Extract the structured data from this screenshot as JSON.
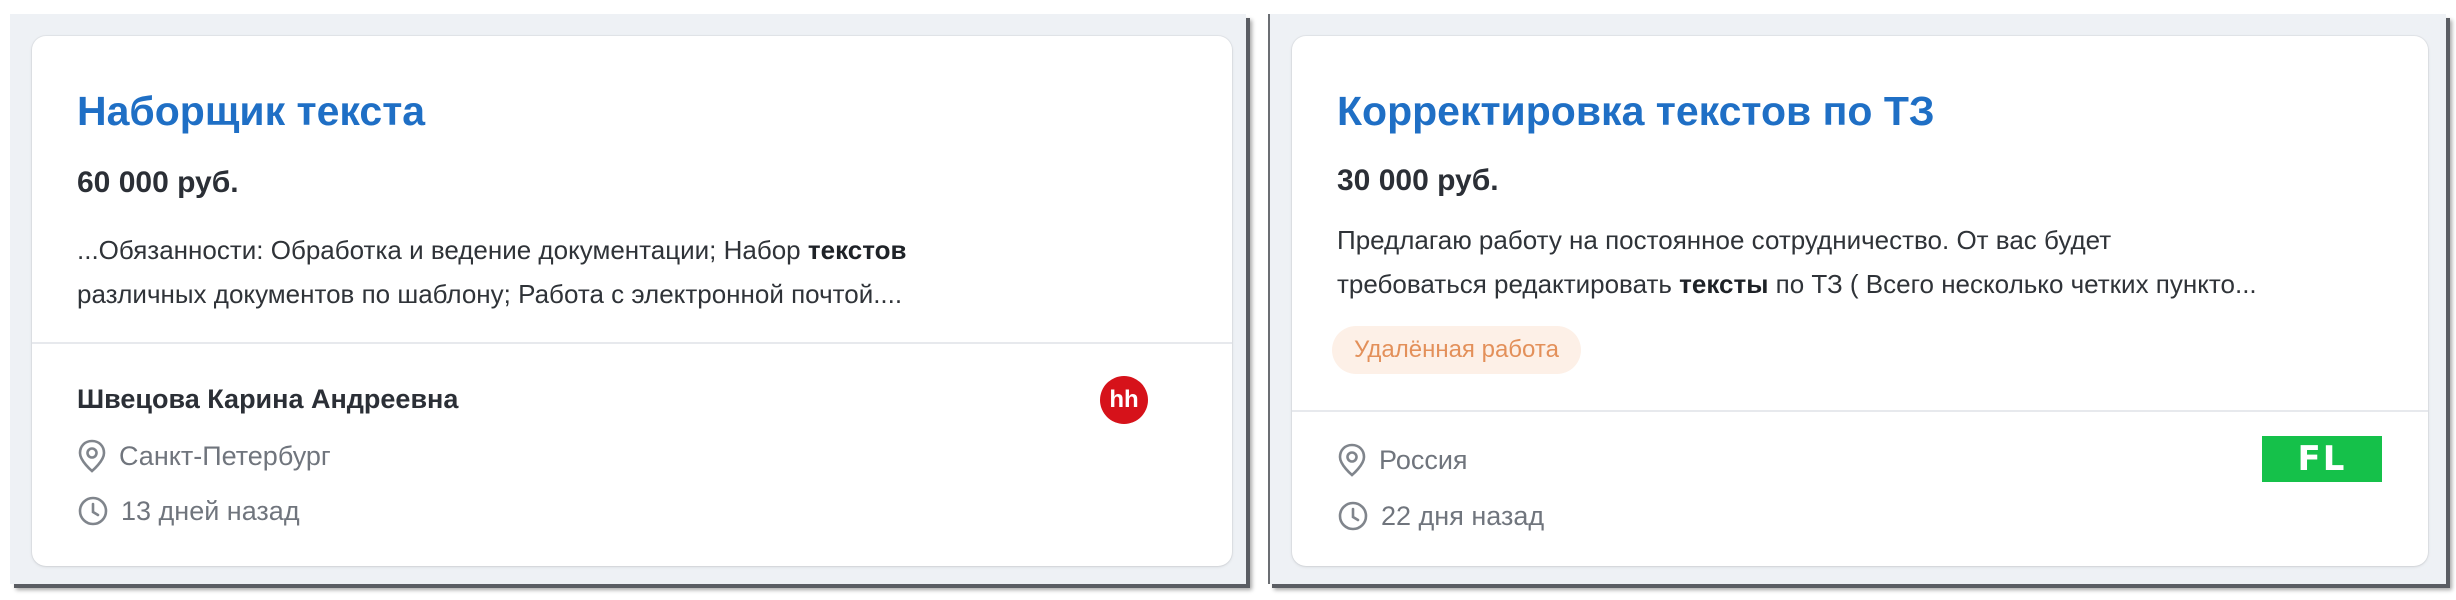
{
  "cards": [
    {
      "title": "Наборщик текста",
      "salary": "60 000 руб.",
      "snippet": {
        "line1_a": "...Обязанности: Обработка и ведение документации; Набор ",
        "line1_bold": "текстов",
        "line2": "различных документов по шаблону; Работа с электронной почтой...."
      },
      "author": "Швецова Карина Андреевна",
      "location": "Санкт-Петербург",
      "posted": "13 дней назад",
      "source_logo": {
        "text": "hh",
        "icon": "hh-logo-icon",
        "color": "#d6121a"
      }
    },
    {
      "title": "Корректировка текстов по ТЗ",
      "salary": "30 000 руб.",
      "snippet": {
        "line1": "Предлагаю работу на постоянное сотрудничество. От вас будет",
        "line2_a": "требоваться редактировать ",
        "line2_bold": "тексты",
        "line2_b": " по ТЗ ( Всего несколько четких пункто..."
      },
      "tag": "Удалённая работа",
      "location": "Россия",
      "posted": "22 дня назад",
      "source_logo": {
        "text": "FL",
        "icon": "fl-logo-icon",
        "color": "#15c14a"
      }
    }
  ],
  "colors": {
    "title": "#1f6fc5",
    "tag_text": "#e3905a",
    "tag_bg": "#fdf0e7",
    "meta_text": "#70757d"
  },
  "icons": [
    "location-pin-icon",
    "clock-icon"
  ]
}
